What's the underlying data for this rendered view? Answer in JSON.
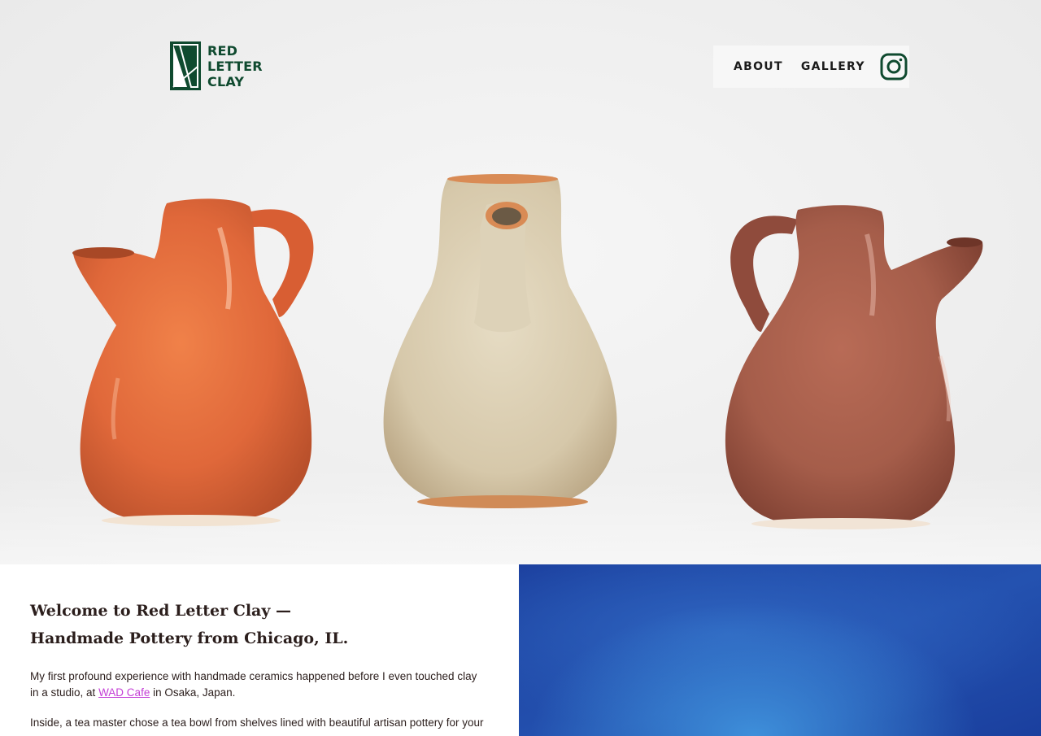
{
  "brand": {
    "logo_lines": [
      "RED",
      "LETTER",
      "CLAY"
    ],
    "color": "#0f4a2f"
  },
  "nav": {
    "items": [
      {
        "label": "ABOUT"
      },
      {
        "label": "GALLERY"
      }
    ],
    "instagram_icon": "instagram-icon"
  },
  "hero": {
    "pitchers": [
      {
        "name": "orange-pitcher",
        "color": "#e0683a"
      },
      {
        "name": "cream-pitcher",
        "color": "#d9cdb2"
      },
      {
        "name": "brown-pitcher",
        "color": "#a55d4a"
      }
    ]
  },
  "intro": {
    "headline_line1": "Welcome to Red Letter Clay —",
    "headline_line2": "Handmade Pottery from Chicago, IL.",
    "p1_before": "My first profound experience with handmade ceramics happened before I even touched clay in a studio, at ",
    "p1_link": "WAD Cafe",
    "p1_after": " in Osaka, Japan.",
    "p2": "Inside, a tea master chose a tea bowl from shelves lined with beautiful artisan pottery for your"
  },
  "colors": {
    "text": "#2b1e1c",
    "link": "#c43fd6",
    "panel_blue": "#2452b0"
  }
}
